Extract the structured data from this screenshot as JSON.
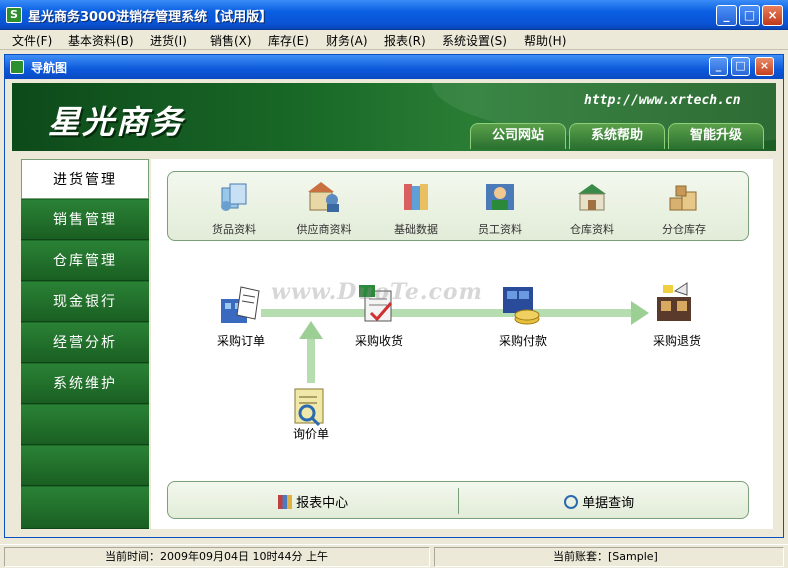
{
  "window": {
    "title": "星光商务3000进销存管理系统【试用版】"
  },
  "menu": [
    "文件(F)",
    "基本资料(B)",
    "进货(I)",
    "销售(X)",
    "库存(E)",
    "财务(A)",
    "报表(R)",
    "系统设置(S)",
    "帮助(H)"
  ],
  "child": {
    "title": "导航图"
  },
  "banner": {
    "brand": "星光商务",
    "website": "http://www.xrtech.cn",
    "tabs": [
      "公司网站",
      "系统帮助",
      "智能升级"
    ]
  },
  "sidebar": {
    "items": [
      "进货管理",
      "销售管理",
      "仓库管理",
      "现金银行",
      "经营分析",
      "系统维护"
    ],
    "active": "进货管理"
  },
  "toolbar": {
    "items": [
      "货品资料",
      "供应商资料",
      "基础数据",
      "员工资料",
      "仓库资料",
      "分仓库存"
    ]
  },
  "flow": {
    "purchase_order": "采购订单",
    "purchase_receipt": "采购收货",
    "purchase_payment": "采购付款",
    "purchase_return": "采购退货",
    "inquiry": "询价单"
  },
  "bottom": {
    "report_center": "报表中心",
    "document_query": "单据查询"
  },
  "status": {
    "time": "当前时间：2009年09月04日 10时44分 上午",
    "account": "当前账套：[Sample]"
  },
  "watermark": "www.DuoTe.com",
  "colors": {
    "titlebar": "#0a53d6",
    "banner_green": "#1a6a28",
    "flow_arrow": "#a8d8a0"
  }
}
